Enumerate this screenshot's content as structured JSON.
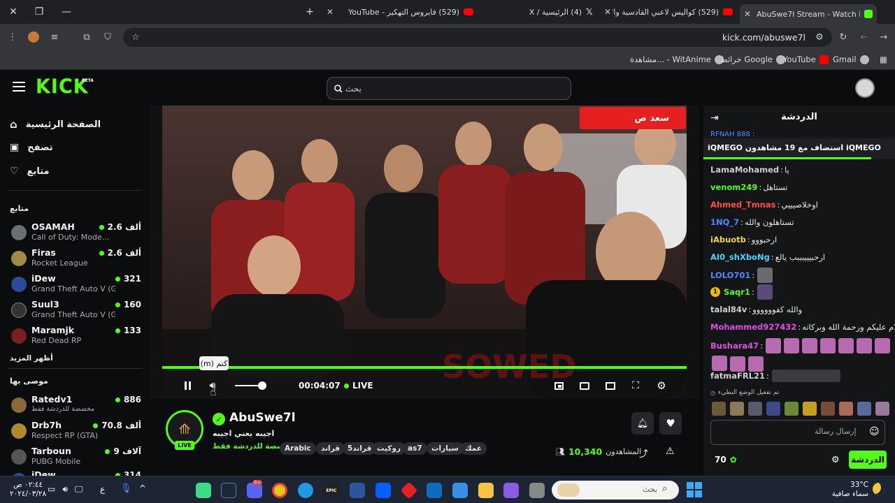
{
  "browser": {
    "tabs": [
      {
        "title": "AbuSwe7l Stream - Watch L",
        "active": true,
        "favicon_color": "#53fc18"
      },
      {
        "title": "(529) كواليس لاعبي القادسية والأ",
        "active": false,
        "favicon_color": "#ff0000"
      },
      {
        "title": "(4) الرئيسية / X",
        "active": false,
        "favicon_color": "#ffffff"
      },
      {
        "title": "(529) فايروس التهكير - YouTube",
        "active": false,
        "favicon_color": "#ff0000"
      }
    ],
    "url": "kick.com/abuswe7l",
    "bookmarks": [
      {
        "label": "Gmail"
      },
      {
        "label": "YouTube"
      },
      {
        "label": "خرائط Google"
      },
      {
        "label": "مشاهدة... - WitAnime"
      }
    ]
  },
  "kick": {
    "logo": "KICK",
    "logo_badge": "BETA",
    "search_placeholder": "بحث",
    "brand_color": "#53fc18"
  },
  "sidebar": {
    "nav": [
      {
        "label": "الصفحة الرئيسية",
        "icon": "home-icon"
      },
      {
        "label": "تصفح",
        "icon": "browse-icon"
      },
      {
        "label": "متابع",
        "icon": "heart-icon"
      }
    ],
    "following_title": "متابع",
    "following": [
      {
        "name": "OSAMAH",
        "game": "Call of Duty: Mode...",
        "viewers": "2.6 ألف",
        "avatar_color": "#6b6e73"
      },
      {
        "name": "Firas",
        "game": "Rocket League",
        "viewers": "2.6 ألف",
        "avatar_color": "#a08a4a"
      },
      {
        "name": "iDew",
        "game": "Grand Theft Auto V (G...",
        "viewers": "321",
        "avatar_color": "#2a4a9a"
      },
      {
        "name": "Suul3",
        "game": "Grand Theft Auto V (G...",
        "viewers": "160",
        "avatar_color": "#333"
      },
      {
        "name": "Maramjk",
        "game": "Red Dead RP",
        "viewers": "133",
        "avatar_color": "#7a1f1f"
      }
    ],
    "show_more": "أظهر المزيد",
    "recommended_title": "موصى بها",
    "recommended": [
      {
        "name": "Ratedv1",
        "game": "مخصصة للدردشة فقط",
        "viewers": "886",
        "avatar_color": "#8a6a3a"
      },
      {
        "name": "Drb7h",
        "game": "Respect RP (GTA)",
        "viewers": "70.8 ألف",
        "avatar_color": "#b08a2a"
      },
      {
        "name": "Tarboun",
        "game": "PUBG Mobile",
        "viewers": "9 آلاف",
        "avatar_color": "#555"
      },
      {
        "name": "iDew",
        "game": "",
        "viewers": "314",
        "avatar_color": "#2a4a9a"
      }
    ]
  },
  "player": {
    "time": "00:04:07",
    "live_label": "LIVE",
    "tooltip": "كتم (m)",
    "overlay_banner": "سعد ص"
  },
  "stream": {
    "name": "AbuSwe7l",
    "title": "اجيبه يعني اجيبه",
    "category": "مخصصة للدردشة فقط",
    "live_badge": "LIVE",
    "tags": [
      "Arabic",
      "قراند",
      "قراند5",
      "روكيت",
      "as7",
      "سيارات",
      "عمك"
    ],
    "viewers_label": "المشاهدون",
    "viewers": "10,340"
  },
  "chat": {
    "title": "الدردشة",
    "pinned_cut": "ٰRFNAH 888 :",
    "host_banner": "iQMEGO استضاف مع 19 مشاهدون iQMEGO",
    "messages": [
      {
        "user": "LamaMohamed",
        "color": "#cfcfcf",
        "text": "يا"
      },
      {
        "user": "venom249",
        "color": "#53fc18",
        "text": "تستاهل"
      },
      {
        "user": "Ahmed_Tmnas",
        "color": "#ff4d4d",
        "text": "اوخلاصيييي"
      },
      {
        "user": "1NQ_7",
        "color": "#4d8bff",
        "text": "تستاهلون والله"
      },
      {
        "user": "iAbuotb",
        "color": "#f5d04a",
        "text": "ارحبووو"
      },
      {
        "user": "AI0_shXboNg",
        "color": "#4dd2ff",
        "text": "ارحبيييبببب يالع"
      },
      {
        "user": "LOLO701",
        "color": "#4d8bff",
        "text": ""
      },
      {
        "user": "Saqr1",
        "color": "#53fc18",
        "text": ""
      },
      {
        "user": "talal84v",
        "color": "#cfcfcf",
        "text": "والله كفوووووو"
      },
      {
        "user": "Mohammed927432",
        "color": "#e04de0",
        "text": "السلام عليكم ورحمة الله وبركاته"
      },
      {
        "user": "Bushara47",
        "color": "#e04de0",
        "text": ""
      },
      {
        "user": "fatmaFRL21",
        "color": "#cfcfcf",
        "text": ""
      }
    ],
    "slow_mode": "تم تفعيل الوضع البطيء",
    "input_placeholder": "إرسال رسالة",
    "send_label": "الدردشة",
    "points": "70"
  },
  "taskbar": {
    "weather_temp": "33°C",
    "weather_text": "سماء صافية",
    "search_placeholder": "بحث",
    "clock_time": "٠٢:٤٤ ص",
    "clock_date": "٢٠٢٤/٠٣/٢٨",
    "lang": "ع",
    "discord_badge": "9+"
  }
}
